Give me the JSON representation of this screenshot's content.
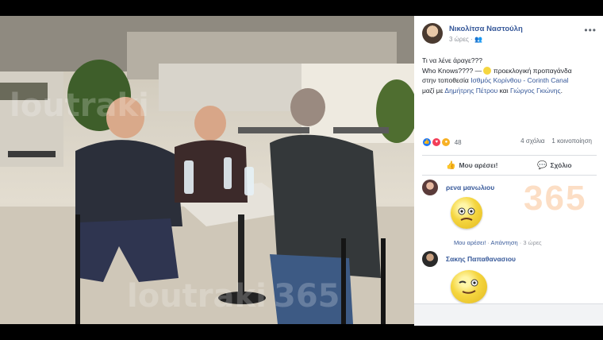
{
  "post": {
    "author": "Νικολίτσα Ναστούλη",
    "time": "3 ώρες",
    "audience_icon": "friends-icon",
    "line1": "Τι να λένε άραγε???",
    "line2a": "Who Knows???? — ",
    "feeling": "προεκλογική προπαγάνδα",
    "loc_prefix": "στην τοποθεσία ",
    "location": "Ισθμός Κορίνθου - Corinth Canal",
    "with_prefix": "μαζί με ",
    "tag1": "Δημήτρης Πέτρου",
    "and": " και ",
    "tag2": "Γιώργος Γκιώνης",
    "end": "."
  },
  "stats": {
    "reactions_count": "48",
    "comments": "4 σχόλια",
    "shares": "1 κοινοποίηση"
  },
  "actions": {
    "like": "Μου αρέσει!",
    "comment": "Σχόλιο"
  },
  "comments": [
    {
      "name": "ρενα μανωλιου",
      "like": "Μου αρέσει!",
      "reply": "Απάντηση",
      "time": "3 ώρες"
    },
    {
      "name": "Σακης Παπαθανασιου"
    }
  ],
  "watermarks": {
    "brand": "loutraki",
    "number": "365"
  },
  "colors": {
    "link": "#365899",
    "like": "#2078f4",
    "love": "#f33e58",
    "wow": "#f7b125"
  }
}
